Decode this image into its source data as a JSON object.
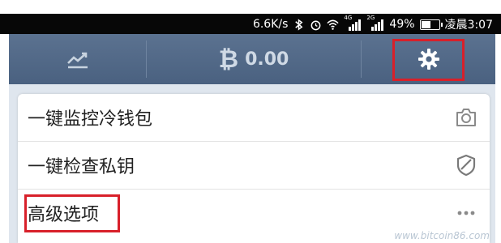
{
  "status_bar": {
    "network_speed": "6.6K/s",
    "signal1_label": "4G",
    "signal2_label": "2G",
    "battery_percent": "49%",
    "time": "凌晨3:07",
    "icons": [
      "bluetooth-icon",
      "alarm-icon",
      "wifi-icon",
      "signal-icon",
      "signal-icon",
      "battery-icon"
    ]
  },
  "toolbar": {
    "chart_icon": "chart-line-icon",
    "currency_icon": "bitcoin-icon",
    "currency_symbol": "₿",
    "balance": "0.00",
    "settings_icon": "gear-icon",
    "highlight_color": "#d8202a"
  },
  "menu": {
    "items": [
      {
        "label": "一键监控冷钱包",
        "icon": "camera-icon"
      },
      {
        "label": "一键检查私钥",
        "icon": "shield-icon"
      },
      {
        "label": "高级选项",
        "icon": "more-dots-icon"
      }
    ]
  },
  "watermark": "www.bitcoin86.com"
}
